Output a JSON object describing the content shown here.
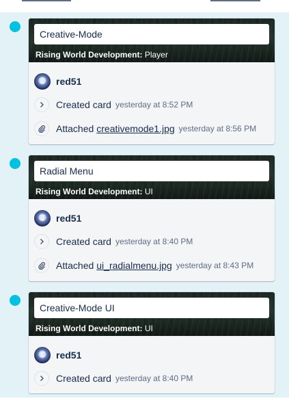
{
  "colors": {
    "dot": "#00c2e0",
    "feed_bg": "#e3f2f6",
    "card_bg": "#f4f5f7",
    "text": "#172b4d",
    "muted": "#5e6c84"
  },
  "entries": [
    {
      "card_title": "Creative-Mode",
      "board_name": "Rising World Development:",
      "list_name": "Player",
      "user": "red51",
      "created_label": "Created card",
      "created_time": "yesterday at 8:52 PM",
      "attached_label": "Attached",
      "attachment_name": "creativemode1.jpg",
      "attached_time": "yesterday at 8:56 PM"
    },
    {
      "card_title": "Radial Menu",
      "board_name": "Rising World Development:",
      "list_name": "UI",
      "user": "red51",
      "created_label": "Created card",
      "created_time": "yesterday at 8:40 PM",
      "attached_label": "Attached",
      "attachment_name": "ui_radialmenu.jpg",
      "attached_time": "yesterday at 8:43 PM"
    },
    {
      "card_title": "Creative-Mode UI",
      "board_name": "Rising World Development:",
      "list_name": "UI",
      "user": "red51",
      "created_label": "Created card",
      "created_time": "yesterday at 8:40 PM"
    }
  ]
}
